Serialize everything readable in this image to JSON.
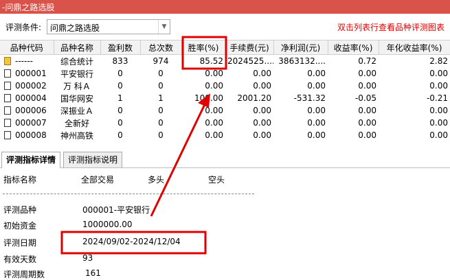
{
  "window": {
    "title": "-问鼎之路选股"
  },
  "condition": {
    "label": "评测条件:",
    "selected": "问鼎之路选股",
    "hint": "双击列表行查看品种评测图表"
  },
  "table": {
    "headers": [
      "品种代码",
      "品种名称",
      "盈利数",
      "总次数",
      "胜率(%)",
      "手续费(元)",
      "净利润(元)",
      "收益率(%)",
      "年化收益率(%)"
    ],
    "rows": [
      {
        "code": "------",
        "name": "综合统计",
        "win": "833",
        "total": "974",
        "rate": "85.52",
        "fee": "2024525....",
        "profit": "3863132....",
        "ret": "0.72",
        "annual": "2.82"
      },
      {
        "code": "000001",
        "name": "平安银行",
        "win": "0",
        "total": "0",
        "rate": "0.00",
        "fee": "0.00",
        "profit": "0.00",
        "ret": "0.00",
        "annual": "0.00"
      },
      {
        "code": "000002",
        "name": "万 科Ａ",
        "win": "0",
        "total": "0",
        "rate": "0.00",
        "fee": "0.00",
        "profit": "0.00",
        "ret": "0.00",
        "annual": "0.00"
      },
      {
        "code": "000004",
        "name": "国华网安",
        "win": "1",
        "total": "1",
        "rate": "100.00",
        "fee": "2001.20",
        "profit": "-531.32",
        "ret": "-0.05",
        "annual": "-0.21"
      },
      {
        "code": "000006",
        "name": "深振业Ａ",
        "win": "0",
        "total": "0",
        "rate": "0.00",
        "fee": "0.00",
        "profit": "0.00",
        "ret": "0.00",
        "annual": "0.00"
      },
      {
        "code": "000007",
        "name": "全新好",
        "win": "0",
        "total": "0",
        "rate": "0.00",
        "fee": "0.00",
        "profit": "0.00",
        "ret": "0.00",
        "annual": "0.00"
      },
      {
        "code": "000008",
        "name": "神州高铁",
        "win": "0",
        "total": "0",
        "rate": "0.00",
        "fee": "0.00",
        "profit": "0.00",
        "ret": "0.00",
        "annual": "0.00"
      }
    ]
  },
  "tabs": [
    "评测指标详情",
    "评测指标说明"
  ],
  "detail": {
    "headers": [
      "指标名称",
      "全部交易",
      "多头",
      "空头"
    ],
    "items": [
      {
        "label": "评测品种",
        "value": "000001-平安银行"
      },
      {
        "label": "初始资金",
        "value": "1000000.00"
      },
      {
        "label": "评测日期",
        "value": "2024/09/02-2024/12/04"
      },
      {
        "label": "有效天数",
        "value": "93"
      },
      {
        "label": "评测周期数",
        "value": "161"
      }
    ]
  },
  "colors": {
    "titlebar": "#d9534a",
    "highlight": "#e00000"
  }
}
